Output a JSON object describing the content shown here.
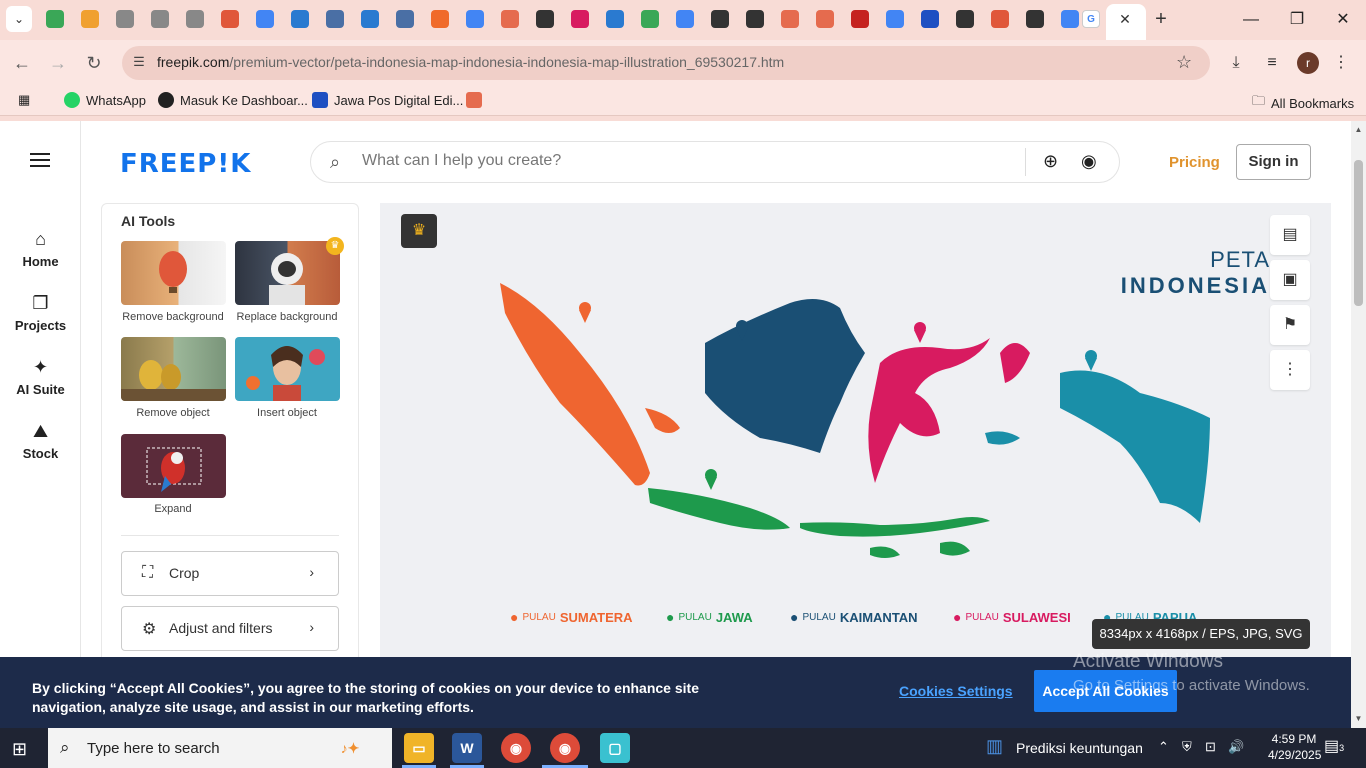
{
  "browser": {
    "url_domain": "freepik.com",
    "url_path": "/premium-vector/peta-indonesia-map-indonesia-indonesia-map-illustration_69530217.htm",
    "bookmarks": [
      {
        "label": "WhatsApp",
        "color": "#25d366"
      },
      {
        "label": "Masuk Ke Dashboar...",
        "color": "#222222"
      },
      {
        "label": "Jawa Pos Digital Edi...",
        "color": "#1e4fc2"
      },
      {
        "label": "",
        "color": "#e56b4e"
      }
    ],
    "all_bookmarks": "All Bookmarks"
  },
  "header": {
    "logo": "FREEP!K",
    "search_placeholder": "What can I help you create?",
    "pricing": "Pricing",
    "sign_in": "Sign in"
  },
  "left_nav": {
    "items": [
      {
        "label": "Home",
        "icon": "home-icon"
      },
      {
        "label": "Projects",
        "icon": "projects-icon"
      },
      {
        "label": "AI Suite",
        "icon": "ai-suite-icon"
      },
      {
        "label": "Stock",
        "icon": "stock-icon"
      }
    ]
  },
  "tools": {
    "title": "AI Tools",
    "items": [
      {
        "label": "Remove background"
      },
      {
        "label": "Replace background"
      },
      {
        "label": "Remove object"
      },
      {
        "label": "Insert object"
      },
      {
        "label": "Expand"
      }
    ],
    "buttons": [
      {
        "label": "Crop"
      },
      {
        "label": "Adjust and filters"
      }
    ]
  },
  "preview": {
    "title_line1": "PETA",
    "title_line2": "INDONESIA",
    "legend": [
      {
        "prefix": "PULAU",
        "name": "SUMATERA",
        "color": "#ef6530"
      },
      {
        "prefix": "PULAU",
        "name": "JAWA",
        "color": "#1e9a4c"
      },
      {
        "prefix": "PULAU",
        "name": "KAIMANTAN",
        "color": "#1a4f74"
      },
      {
        "prefix": "PULAU",
        "name": "SULAWESI",
        "color": "#d81b60"
      },
      {
        "prefix": "PULAU",
        "name": "PAPUA",
        "color": "#1a8fa8"
      }
    ],
    "dimensions": "8334px x 4168px / EPS, JPG, SVG"
  },
  "cookie": {
    "text": "By clicking “Accept All Cookies”, you agree to the storing of cookies on your device to enhance site navigation, analyze site usage, and assist in our marketing efforts.",
    "settings": "Cookies Settings",
    "accept": "Accept All Cookies"
  },
  "watermark": {
    "line1": "Activate Windows",
    "line2": "Go to Settings to activate Windows."
  },
  "taskbar": {
    "search_placeholder": "Type here to search",
    "tray_app": "Prediksi keuntungan",
    "time": "4:59 PM",
    "date": "4/29/2025",
    "notifications": "3"
  }
}
